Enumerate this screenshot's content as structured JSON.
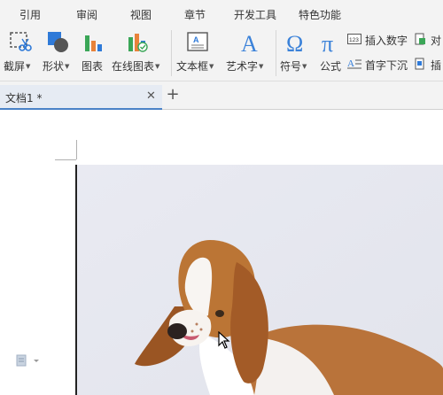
{
  "menu": {
    "items": [
      "引用",
      "审阅",
      "视图",
      "章节",
      "开发工具",
      "特色功能"
    ]
  },
  "ribbon": {
    "screenshot_label": "截屏",
    "shape_label": "形状",
    "chart_label": "图表",
    "online_chart_label": "在线图表",
    "textbox_label": "文本框",
    "wordart_label": "艺术字",
    "symbol_label": "符号",
    "formula_label": "公式",
    "insert_number_label": "插入数字",
    "dropcap_label": "首字下沉",
    "object_label": "对",
    "insert_label": "插"
  },
  "tabs": {
    "doc_title": "文档1 *"
  },
  "colors": {
    "accent": "#4a82c7",
    "toolbar_bg": "#f3f3f3",
    "icon_blue": "#2f7ad8",
    "icon_green": "#3aa657",
    "icon_orange": "#e8823a"
  }
}
